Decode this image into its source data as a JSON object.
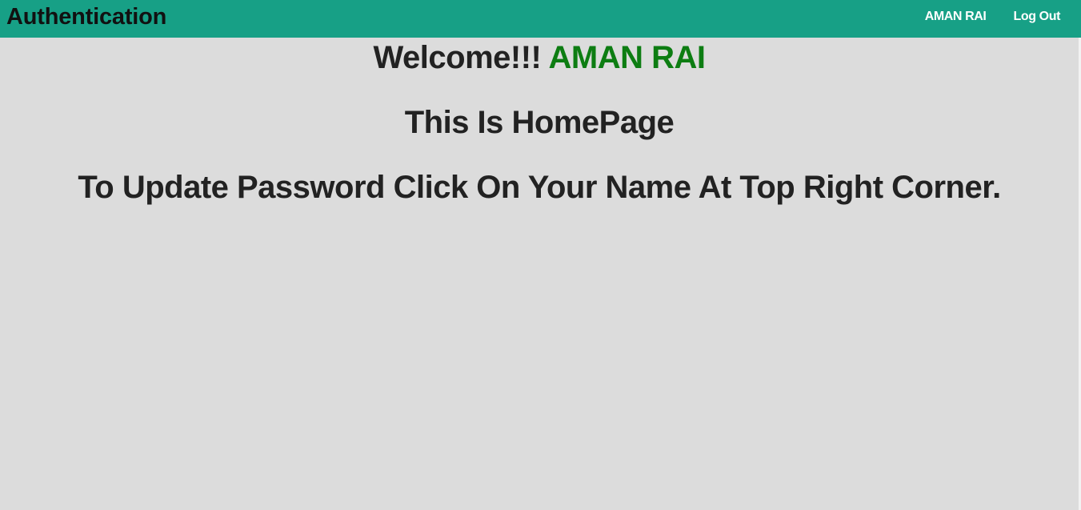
{
  "navbar": {
    "brand": "Authentication",
    "user_link": "AMAN RAI",
    "logout_link": "Log Out"
  },
  "main": {
    "welcome_prefix": "Welcome!!! ",
    "welcome_name": "AMAN RAI",
    "homepage_text": "This Is HomePage",
    "instruction_text": "To Update Password Click On Your Name At Top Right Corner."
  },
  "colors": {
    "navbar_background": "#17a086",
    "page_background": "#dcdcdc",
    "name_highlight": "#0d7d12",
    "text": "#222222"
  }
}
